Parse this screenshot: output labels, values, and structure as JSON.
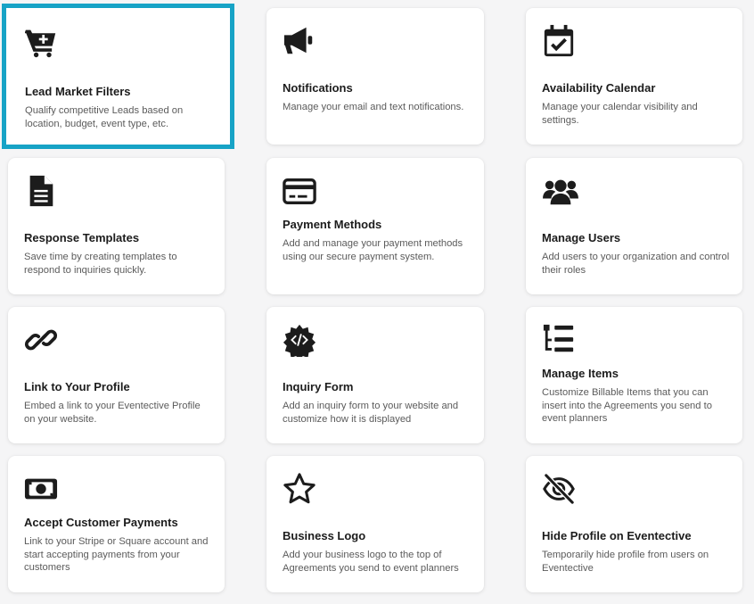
{
  "cards": [
    {
      "title": "Lead Market Filters",
      "desc": "Qualify competitive Leads based on location, budget, event type, etc.",
      "icon": "cart-plus-icon"
    },
    {
      "title": "Notifications",
      "desc": "Manage your email and text notifications.",
      "icon": "megaphone-icon"
    },
    {
      "title": "Availability Calendar",
      "desc": "Manage your calendar visibility and settings.",
      "icon": "calendar-check-icon"
    },
    {
      "title": "Response Templates",
      "desc": "Save time by creating templates to respond to inquiries quickly.",
      "icon": "file-text-icon"
    },
    {
      "title": "Payment Methods",
      "desc": "Add and manage your payment methods using our secure payment system.",
      "icon": "credit-card-icon"
    },
    {
      "title": "Manage Users",
      "desc": "Add users to your organization and control their roles",
      "icon": "users-icon"
    },
    {
      "title": "Link to Your Profile",
      "desc": "Embed a link to your Eventective Profile on your website.",
      "icon": "link-icon"
    },
    {
      "title": "Inquiry Form",
      "desc": "Add an inquiry form to your website and customize how it is displayed",
      "icon": "code-gear-icon"
    },
    {
      "title": "Manage Items",
      "desc": "Customize Billable Items that you can insert into the Agreements you send to event planners",
      "icon": "list-tree-icon"
    },
    {
      "title": "Accept Customer Payments",
      "desc": "Link to your Stripe or Square account and start accepting payments from your customers",
      "icon": "money-bill-icon"
    },
    {
      "title": "Business Logo",
      "desc": "Add your business logo to the top of Agreements you send to event planners",
      "icon": "star-icon"
    },
    {
      "title": "Hide Profile on Eventective",
      "desc": "Temporarily hide profile from users on Eventective",
      "icon": "eye-slash-icon"
    }
  ],
  "colors": {
    "accent": "#17a3c6",
    "icon": "#1c1c1c"
  }
}
